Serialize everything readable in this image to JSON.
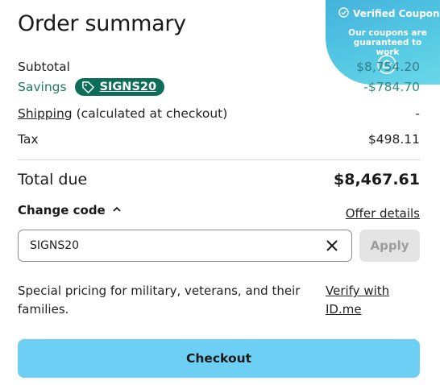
{
  "title": "Order summary",
  "subtotal": {
    "label": "Subtotal",
    "value": "$8,754.20"
  },
  "savings": {
    "label": "Savings",
    "coupon_code": "SIGNS20",
    "value": "-$784.70"
  },
  "shipping": {
    "link_label": "Shipping",
    "note": "(calculated at checkout)",
    "value": "-"
  },
  "tax": {
    "label": "Tax",
    "value": "$498.11"
  },
  "total": {
    "label": "Total due",
    "value": "$8,467.61"
  },
  "change_code": {
    "label": "Change code"
  },
  "offer_details": {
    "label": "Offer details"
  },
  "code_input": {
    "value": "SIGNS20"
  },
  "apply": {
    "label": "Apply"
  },
  "special_pricing": {
    "text": "Special pricing for military, veterans, and their families.",
    "link": "Verify with ID.me"
  },
  "checkout": {
    "label": "Checkout"
  },
  "badge": {
    "title": "Verified Coupon",
    "subtitle": "Our coupons are guaranteed to work"
  },
  "colors": {
    "accent_green": "#0c6e58",
    "checkout_blue": "#6dcff3",
    "badge_blue": "#2aa9d8"
  },
  "icons": {
    "coupon": "tag-icon",
    "clear": "close-icon",
    "chevron": "chevron-up-icon",
    "verified": "check-circle-icon",
    "seal": "badge-seal-icon"
  }
}
